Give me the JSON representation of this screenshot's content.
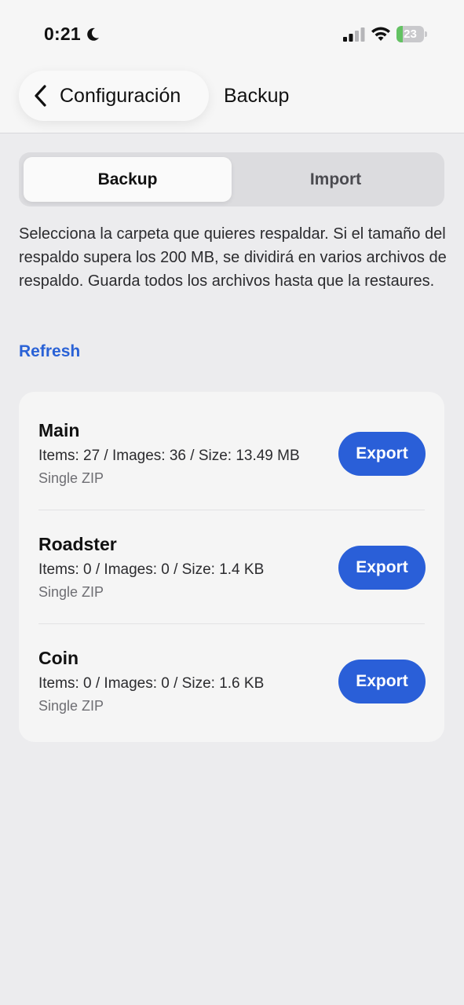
{
  "status_bar": {
    "time": "0:21",
    "battery": "23",
    "battery_level": 0.23,
    "icons": [
      "moon-icon",
      "signal-icon",
      "wifi-icon",
      "battery-icon"
    ]
  },
  "nav": {
    "back_label": "Configuración",
    "title": "Backup"
  },
  "segments": {
    "backup": "Backup",
    "import": "Import",
    "selected": "Backup"
  },
  "description": "Selecciona la carpeta que quieres respaldar. Si el tamaño del respaldo supera los 200 MB, se dividirá en varios archivos de respaldo. Guarda todos los archivos hasta que la restaures.",
  "refresh_label": "Refresh",
  "folders": [
    {
      "name": "Main",
      "stats": "Items: 27 / Images: 36 / Size: 13.49 MB",
      "format": "Single ZIP",
      "button": "Export"
    },
    {
      "name": "Roadster",
      "stats": "Items: 0 / Images: 0 / Size: 1.4 KB",
      "format": "Single ZIP",
      "button": "Export"
    },
    {
      "name": "Coin",
      "stats": "Items: 0 / Images: 0 / Size: 1.6 KB",
      "format": "Single ZIP",
      "button": "Export"
    }
  ],
  "colors": {
    "accent": "#2a5fd8",
    "link": "#2a62d6",
    "battery_fill": "#63c262",
    "background": "#ececee"
  }
}
